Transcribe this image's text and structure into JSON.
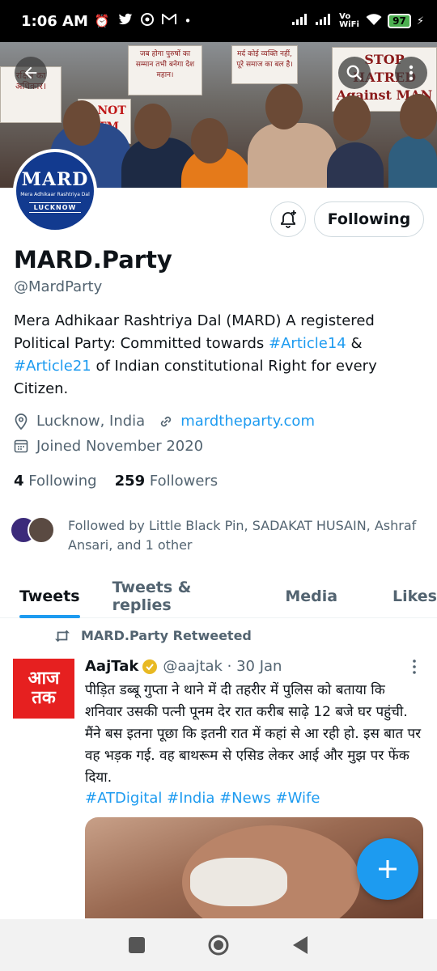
{
  "status_bar": {
    "time": "1:06 AM",
    "battery": "97",
    "network_label": "Vo WiFi"
  },
  "banner": {
    "signs": [
      "जब होगा पुरुषों का सम्मान तभी बनेगा देश महान।",
      "मर्द कोई व्यक्ति नहीं, पूरे समाज का बल है।",
      "STOP HATRED Against MAN",
      "is NOT ATM",
      "रक्षित का अधिकार।"
    ]
  },
  "avatar": {
    "title": "MARD",
    "subtitle": "Mera Adhikaar Rashtriya Dal",
    "city": "LUCKNOW"
  },
  "profile": {
    "following_button": "Following",
    "name": "MARD.Party",
    "handle": "@MardParty",
    "bio_part1": "Mera Adhikaar Rashtriya Dal (MARD) A registered Political Party: Committed towards ",
    "bio_tag1": "#Article14",
    "bio_part2": " & ",
    "bio_tag2": "#Article21",
    "bio_part3": " of Indian constitutional Right for every Citizen.",
    "location": "Lucknow, India",
    "website": "mardtheparty.com",
    "joined": "Joined November 2020",
    "following_count": "4",
    "following_label": "Following",
    "followers_count": "259",
    "followers_label": "Followers",
    "followed_by": "Followed by Little Black Pin, SADAKAT HUSAIN, Ashraf Ansari, and 1 other"
  },
  "tabs": [
    {
      "label": "Tweets"
    },
    {
      "label": "Tweets & replies"
    },
    {
      "label": "Media"
    },
    {
      "label": "Likes"
    }
  ],
  "tweet": {
    "retweeted_by": "MARD.Party Retweeted",
    "avatar_text_top": "आज",
    "avatar_text_bottom": "तक",
    "author_name": "AajTak",
    "author_handle_date": "@aajtak · 30 Jan",
    "text": "पीड़ित डब्बू गुप्ता ने थाने में दी तहरीर में पुलिस को बताया कि शनिवार उसकी पत्नी पूनम देर रात करीब साढ़े 12 बजे घर पहुंची. मैंने बस इतना पूछा कि इतनी रात में कहां से आ रही हो. इस बात पर वह भड़क गई. वह बाथरूम से एसिड लेकर आई और मुझ पर फेंक दिया.",
    "hashtags": "#ATDigital #India #News #Wife"
  },
  "colors": {
    "accent": "#1d9bf0",
    "text_primary": "#0f1419",
    "text_secondary": "#536471",
    "aajtak_red": "#e62020"
  },
  "icons": [
    "back-arrow-icon",
    "search-icon",
    "more-vertical-icon",
    "bell-plus-icon",
    "location-pin-icon",
    "link-icon",
    "calendar-icon",
    "retweet-icon",
    "verified-badge-icon",
    "compose-plus-icon",
    "nav-square-icon",
    "nav-home-icon",
    "nav-back-icon"
  ]
}
